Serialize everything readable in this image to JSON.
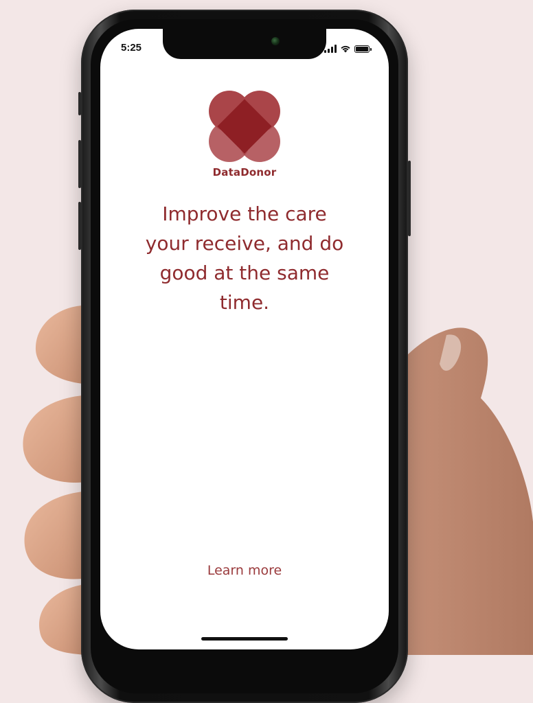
{
  "status_bar": {
    "time": "5:25",
    "signal_icon": "cellular-signal-icon",
    "wifi_icon": "wifi-icon",
    "battery_icon": "battery-icon"
  },
  "app": {
    "brand_name": "DataDonor",
    "logo_icon": "heart-clover-logo-icon",
    "headline": "Improve the care your receive, and do good at the same time.",
    "learn_more_label": "Learn more"
  },
  "colors": {
    "brand": "#8f2b2e",
    "background": "#f3e7e7",
    "screen": "#ffffff"
  }
}
